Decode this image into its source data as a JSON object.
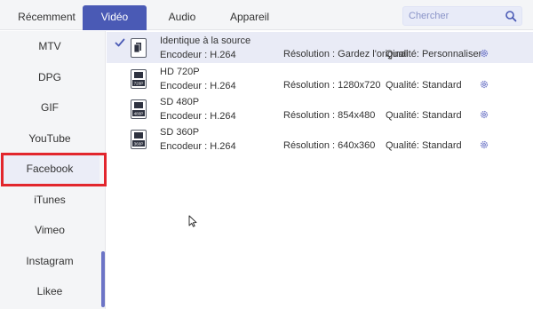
{
  "tabs": [
    {
      "label": "Récemment",
      "active": false
    },
    {
      "label": "Vidéo",
      "active": true
    },
    {
      "label": "Audio",
      "active": false
    },
    {
      "label": "Appareil",
      "active": false
    }
  ],
  "search": {
    "placeholder": "Chercher",
    "icon": "search-icon"
  },
  "sidebar": {
    "items": [
      {
        "label": "MTV"
      },
      {
        "label": "DPG"
      },
      {
        "label": "GIF"
      },
      {
        "label": "YouTube"
      },
      {
        "label": "Facebook",
        "selected": true,
        "highlighted": true
      },
      {
        "label": "iTunes"
      },
      {
        "label": "Vimeo"
      },
      {
        "label": "Instagram"
      },
      {
        "label": "Likee"
      }
    ]
  },
  "presets": [
    {
      "name": "Identique à la source",
      "icon_label": "",
      "encoder": "Encodeur : H.264",
      "resolution": "Résolution : Gardez l'original",
      "quality": "Qualité: Personnaliser",
      "selected": true
    },
    {
      "name": "HD 720P",
      "icon_label": "720P",
      "encoder": "Encodeur : H.264",
      "resolution": "Résolution : 1280x720",
      "quality": "Qualité: Standard",
      "selected": false
    },
    {
      "name": "SD 480P",
      "icon_label": "480P",
      "encoder": "Encodeur : H.264",
      "resolution": "Résolution : 854x480",
      "quality": "Qualité: Standard",
      "selected": false
    },
    {
      "name": "SD 360P",
      "icon_label": "360P",
      "encoder": "Encodeur : H.264",
      "resolution": "Résolution : 640x360",
      "quality": "Qualité: Standard",
      "selected": false
    }
  ],
  "colors": {
    "accent": "#4a5ab5",
    "highlight_box": "#e2262d",
    "row_selected": "#e9ebf6"
  }
}
